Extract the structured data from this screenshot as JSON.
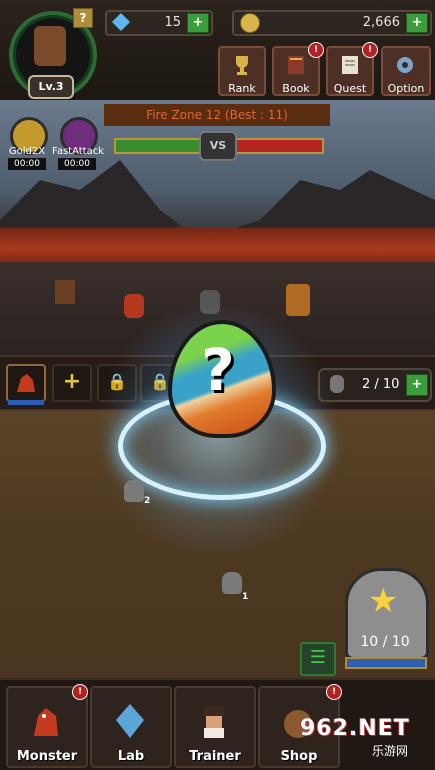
{
  "player": {
    "level_label": "Lv.3",
    "help_label": "?"
  },
  "currency": {
    "gems": "15",
    "gold": "2,666",
    "add_label": "+"
  },
  "menu": [
    {
      "label": "Rank",
      "icon": "trophy-icon",
      "alert": false
    },
    {
      "label": "Book",
      "icon": "book-icon",
      "alert": true
    },
    {
      "label": "Quest",
      "icon": "scroll-icon",
      "alert": true
    },
    {
      "label": "Option",
      "icon": "gear-icon",
      "alert": false
    }
  ],
  "alert_glyph": "!",
  "zone": {
    "title": "Fire Zone 12 (Best : 11)",
    "vs_label": "VS",
    "player_hp_fraction": 0.5,
    "enemy_hp_fraction": 0.5
  },
  "buffs": [
    {
      "label": "Gold2X",
      "time": "00:00",
      "color": "#c29a2e"
    },
    {
      "label": "FastAttack",
      "time": "00:00",
      "color": "#6f2d7d"
    }
  ],
  "team_slots": [
    {
      "state": "monster",
      "glyph": ""
    },
    {
      "state": "add",
      "glyph": "+"
    },
    {
      "state": "locked",
      "glyph": "🔒"
    },
    {
      "state": "locked",
      "glyph": "🔒"
    }
  ],
  "capacity": {
    "text": "2 / 10",
    "add_label": "+"
  },
  "egg": {
    "glyph": "?"
  },
  "ground_monsters": [
    {
      "num": "2"
    },
    {
      "num": "1"
    }
  ],
  "storage": {
    "count": "10 / 10",
    "star": "★",
    "list_glyph": "☰"
  },
  "tabs": [
    {
      "label": "Monster",
      "icon": "dragon-icon",
      "alert": true
    },
    {
      "label": "Lab",
      "icon": "crystal-icon",
      "alert": false
    },
    {
      "label": "Trainer",
      "icon": "trainer-icon",
      "alert": false
    },
    {
      "label": "Shop",
      "icon": "pot-icon",
      "alert": true
    }
  ],
  "watermark": {
    "brand": "962.NET",
    "sub": "乐游网"
  },
  "colors": {
    "accent_green": "#3b9d3c",
    "alert_red": "#b52021",
    "zone_text": "#e06634"
  }
}
